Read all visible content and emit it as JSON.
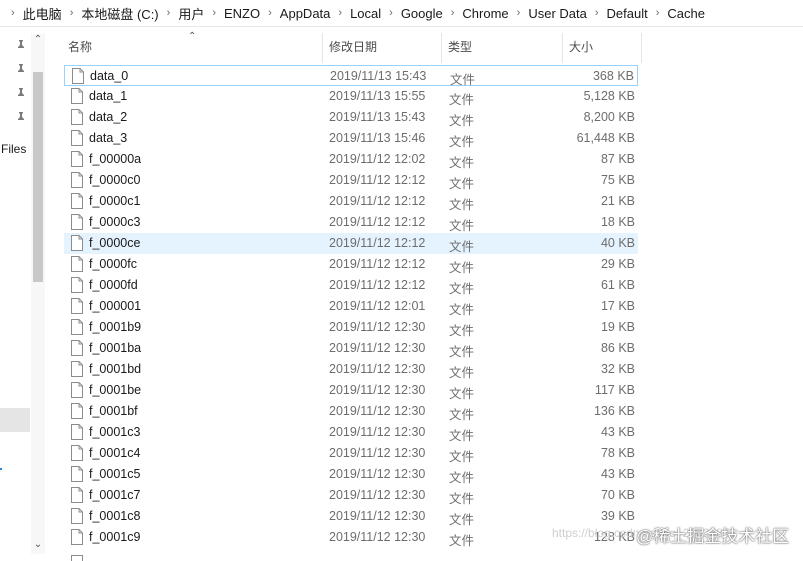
{
  "breadcrumb": [
    "此电脑",
    "本地磁盘 (C:)",
    "用户",
    "ENZO",
    "AppData",
    "Local",
    "Google",
    "Chrome",
    "User Data",
    "Default",
    "Cache"
  ],
  "nav": {
    "label": "Files"
  },
  "columns": {
    "name": "名称",
    "date": "修改日期",
    "type": "类型",
    "size": "大小"
  },
  "files": [
    {
      "name": "data_0",
      "date": "2019/11/13 15:43",
      "type": "文件",
      "size": "368 KB"
    },
    {
      "name": "data_1",
      "date": "2019/11/13 15:55",
      "type": "文件",
      "size": "5,128 KB"
    },
    {
      "name": "data_2",
      "date": "2019/11/13 15:43",
      "type": "文件",
      "size": "8,200 KB"
    },
    {
      "name": "data_3",
      "date": "2019/11/13 15:46",
      "type": "文件",
      "size": "61,448 KB"
    },
    {
      "name": "f_00000a",
      "date": "2019/11/12 12:02",
      "type": "文件",
      "size": "87 KB"
    },
    {
      "name": "f_0000c0",
      "date": "2019/11/12 12:12",
      "type": "文件",
      "size": "75 KB"
    },
    {
      "name": "f_0000c1",
      "date": "2019/11/12 12:12",
      "type": "文件",
      "size": "21 KB"
    },
    {
      "name": "f_0000c3",
      "date": "2019/11/12 12:12",
      "type": "文件",
      "size": "18 KB"
    },
    {
      "name": "f_0000ce",
      "date": "2019/11/12 12:12",
      "type": "文件",
      "size": "40 KB"
    },
    {
      "name": "f_0000fc",
      "date": "2019/11/12 12:12",
      "type": "文件",
      "size": "29 KB"
    },
    {
      "name": "f_0000fd",
      "date": "2019/11/12 12:12",
      "type": "文件",
      "size": "61 KB"
    },
    {
      "name": "f_000001",
      "date": "2019/11/12 12:01",
      "type": "文件",
      "size": "17 KB"
    },
    {
      "name": "f_0001b9",
      "date": "2019/11/12 12:30",
      "type": "文件",
      "size": "19 KB"
    },
    {
      "name": "f_0001ba",
      "date": "2019/11/12 12:30",
      "type": "文件",
      "size": "86 KB"
    },
    {
      "name": "f_0001bd",
      "date": "2019/11/12 12:30",
      "type": "文件",
      "size": "32 KB"
    },
    {
      "name": "f_0001be",
      "date": "2019/11/12 12:30",
      "type": "文件",
      "size": "117 KB"
    },
    {
      "name": "f_0001bf",
      "date": "2019/11/12 12:30",
      "type": "文件",
      "size": "136 KB"
    },
    {
      "name": "f_0001c3",
      "date": "2019/11/12 12:30",
      "type": "文件",
      "size": "43 KB"
    },
    {
      "name": "f_0001c4",
      "date": "2019/11/12 12:30",
      "type": "文件",
      "size": "78 KB"
    },
    {
      "name": "f_0001c5",
      "date": "2019/11/12 12:30",
      "type": "文件",
      "size": "43 KB"
    },
    {
      "name": "f_0001c7",
      "date": "2019/11/12 12:30",
      "type": "文件",
      "size": "70 KB"
    },
    {
      "name": "f_0001c8",
      "date": "2019/11/12 12:30",
      "type": "文件",
      "size": "39 KB"
    },
    {
      "name": "f_0001c9",
      "date": "2019/11/12 12:30",
      "type": "文件",
      "size": "128 KB"
    }
  ],
  "watermark": {
    "url": "https://blog.csdn.net/qq_23023851",
    "brand": "@稀土掘金技术社区"
  }
}
